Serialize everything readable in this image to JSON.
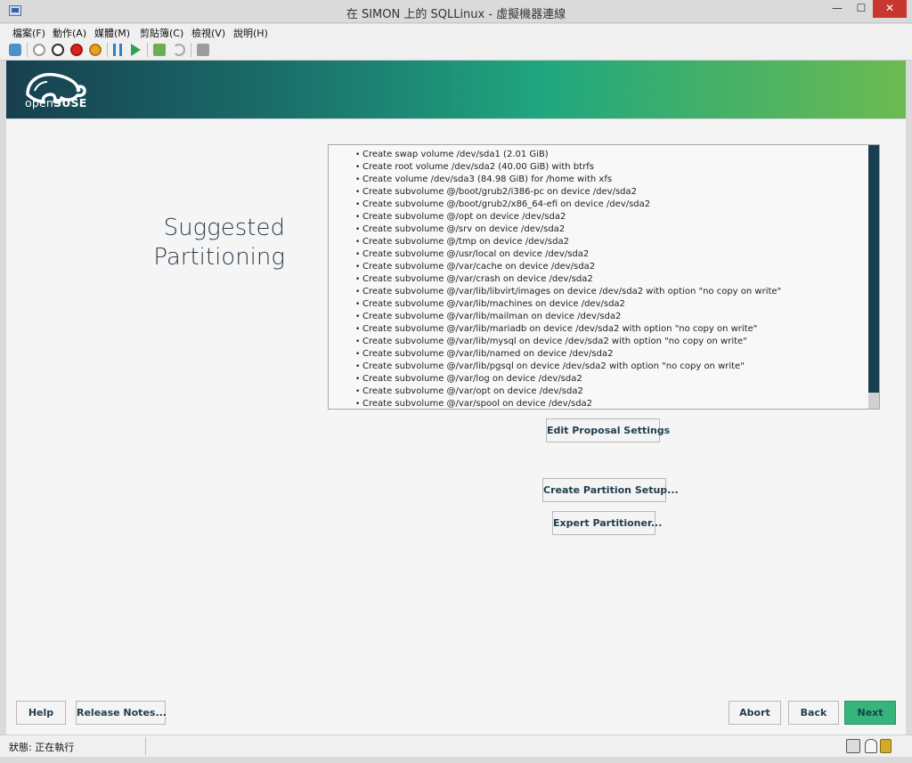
{
  "window": {
    "title": "在 SIMON 上的 SQLLinux - 虛擬機器連線",
    "min_glyph": "—",
    "max_glyph": "☐",
    "close_glyph": "✕"
  },
  "menubar": {
    "items": [
      "檔案(F)",
      "動作(A)",
      "媒體(M)",
      "剪貼簿(C)",
      "檢視(V)",
      "說明(H)"
    ]
  },
  "toolbar": {
    "icons": [
      "ctrl-alt-del-icon",
      "start-icon",
      "turn-off-icon",
      "shutdown-icon",
      "save-icon",
      "pause-icon",
      "resume-icon",
      "checkpoint-icon",
      "revert-icon",
      "enhanced-session-icon"
    ]
  },
  "installer": {
    "brand": {
      "prefix": "open",
      "name": "SUSE"
    },
    "heading": [
      "Suggested",
      "Partitioning"
    ],
    "proposal": [
      "Create swap volume /dev/sda1 (2.01 GiB)",
      "Create root volume /dev/sda2 (40.00 GiB) with btrfs",
      "Create volume /dev/sda3 (84.98 GiB) for /home with xfs",
      "Create subvolume @/boot/grub2/i386-pc on device /dev/sda2",
      "Create subvolume @/boot/grub2/x86_64-efi on device /dev/sda2",
      "Create subvolume @/opt on device /dev/sda2",
      "Create subvolume @/srv on device /dev/sda2",
      "Create subvolume @/tmp on device /dev/sda2",
      "Create subvolume @/usr/local on device /dev/sda2",
      "Create subvolume @/var/cache on device /dev/sda2",
      "Create subvolume @/var/crash on device /dev/sda2",
      "Create subvolume @/var/lib/libvirt/images on device /dev/sda2 with option \"no copy on write\"",
      "Create subvolume @/var/lib/machines on device /dev/sda2",
      "Create subvolume @/var/lib/mailman on device /dev/sda2",
      "Create subvolume @/var/lib/mariadb on device /dev/sda2 with option \"no copy on write\"",
      "Create subvolume @/var/lib/mysql on device /dev/sda2 with option \"no copy on write\"",
      "Create subvolume @/var/lib/named on device /dev/sda2",
      "Create subvolume @/var/lib/pgsql on device /dev/sda2 with option \"no copy on write\"",
      "Create subvolume @/var/log on device /dev/sda2",
      "Create subvolume @/var/opt on device /dev/sda2",
      "Create subvolume @/var/spool on device /dev/sda2"
    ],
    "buttons": {
      "edit_proposal": "Edit Proposal Settings",
      "create_setup": "Create Partition Setup...",
      "expert": "Expert Partitioner...",
      "help": "Help",
      "release_notes": "Release Notes...",
      "abort": "Abort",
      "back": "Back",
      "next": "Next"
    }
  },
  "statusbar": {
    "text": "狀態: 正在執行"
  }
}
